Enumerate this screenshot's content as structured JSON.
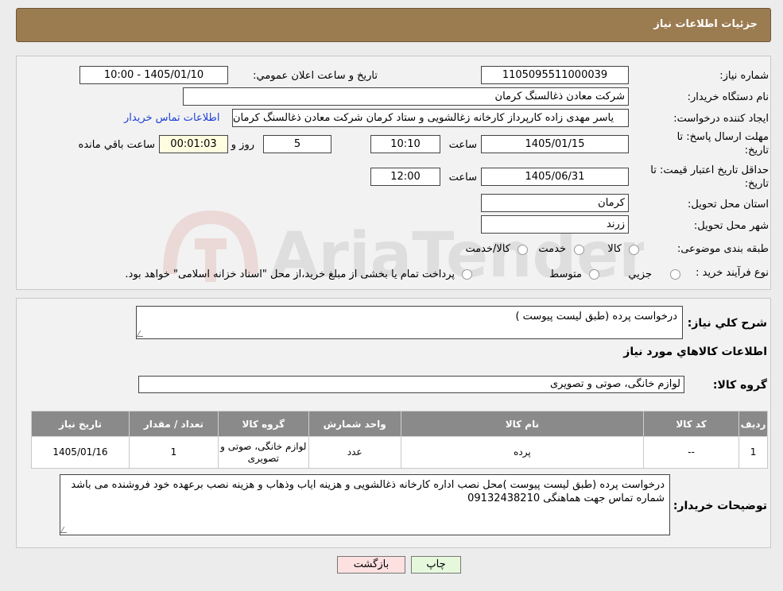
{
  "header": {
    "title": "جزئيات اطلاعات نياز"
  },
  "labels": {
    "need_number": "شماره نياز:",
    "announce_datetime": "تاريخ و ساعت اعلان عمومي:",
    "buyer_org": "نام دستگاه خريدار:",
    "requester": "ايجاد کننده درخواست:",
    "reply_deadline_line1": "مهلت ارسال پاسخ: تا",
    "reply_deadline_line2": "تاريخ:",
    "time": "ساعت",
    "days_and": "روز و",
    "remaining": "ساعت باقي مانده",
    "price_validity_line1": "حداقل تاريخ اعتبار قيمت: تا",
    "price_validity_line2": "تاريخ:",
    "province": "استان محل تحويل:",
    "city": "شهر محل تحويل:",
    "category": "طبقه بندی موضوعی:",
    "purchase_type": "نوع فرآيند خريد :",
    "description": "شرح کلي نياز:",
    "goods_info": "اطلاعات کالاهاي مورد نياز",
    "goods_group": "گروه کالا:",
    "buyer_notes": "توضيحات خريدار:"
  },
  "fields": {
    "need_number": "1105095511000039",
    "announce_datetime": "1405/01/10 - 10:00",
    "buyer_org": "شرکت معادن ذغالسنگ کرمان",
    "requester": "یاسر مهدی زاده کارپرداز کارخانه زغالشویی و ستاد کرمان شرکت معادن ذغالسنگ کرمان",
    "contact_link": "اطلاعات تماس خريدار",
    "reply_date": "1405/01/15",
    "reply_time": "10:10",
    "days": "5",
    "remaining_time": "00:01:03",
    "validity_date": "1405/06/31",
    "validity_time": "12:00",
    "province": "کرمان",
    "city": "زرند",
    "category_options": [
      "کالا",
      "خدمت",
      "کالا/خدمت"
    ],
    "purchase_options": [
      "جزيي",
      "متوسط"
    ],
    "purchase_note": "پرداخت تمام يا بخشی از مبلغ خريد،از محل \"اسناد خزانه اسلامی\" خواهد بود.",
    "description": "درخواست پرده (طبق لیست پیوست )",
    "goods_group": "لوازم خانگی، صوتی و تصویری",
    "buyer_notes": "درخواست پرده (طبق لیست پیوست )محل نصب اداره کارخانه ذغالشویی و هزینه ایاب وذهاب و هزینه نصب برعهده خود فروشنده می باشد شماره تماس جهت هماهنگی 09132438210"
  },
  "table": {
    "headers": [
      "رديف",
      "کد کالا",
      "نام کالا",
      "واحد شمارش",
      "گروه کالا",
      "تعداد / مقدار",
      "تاريخ نياز"
    ],
    "rows": [
      [
        "1",
        "--",
        "پرده",
        "عدد",
        "لوازم خانگی، صوتی و تصویری",
        "1",
        "1405/01/16"
      ]
    ]
  },
  "buttons": {
    "print": "چاپ",
    "back": "بازگشت"
  },
  "watermark": {
    "text": "AriaTender.neT"
  },
  "colors": {
    "header_bg": "#9b7b50",
    "link": "#1c3fd8",
    "table_header": "#8a8a8a",
    "back_btn": "#fde0e0",
    "print_btn": "#e6f8dc"
  }
}
